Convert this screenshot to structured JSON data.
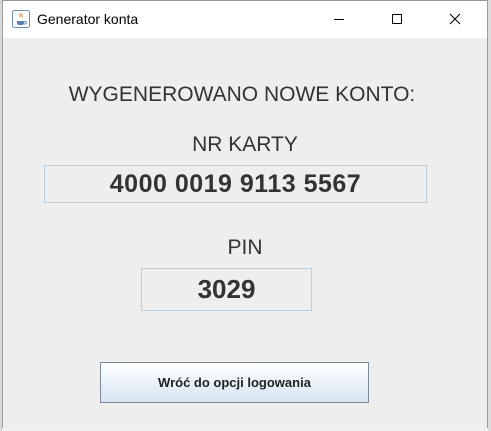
{
  "window": {
    "title": "Generator konta"
  },
  "content": {
    "heading": "WYGENEROWANO NOWE KONTO:",
    "card_label": "NR KARTY",
    "card_number": "4000 0019 9113 5567",
    "pin_label": "PIN",
    "pin_value": "3029",
    "back_button": "Wróć do opcji logowania"
  },
  "icons": {
    "app": "java-icon",
    "minimize": "minimize-icon",
    "maximize": "maximize-icon",
    "close": "close-icon"
  },
  "colors": {
    "window_bg": "#eeeeee",
    "field_border": "#b8cfe0",
    "button_gradient_bottom": "#d6e4f2"
  }
}
